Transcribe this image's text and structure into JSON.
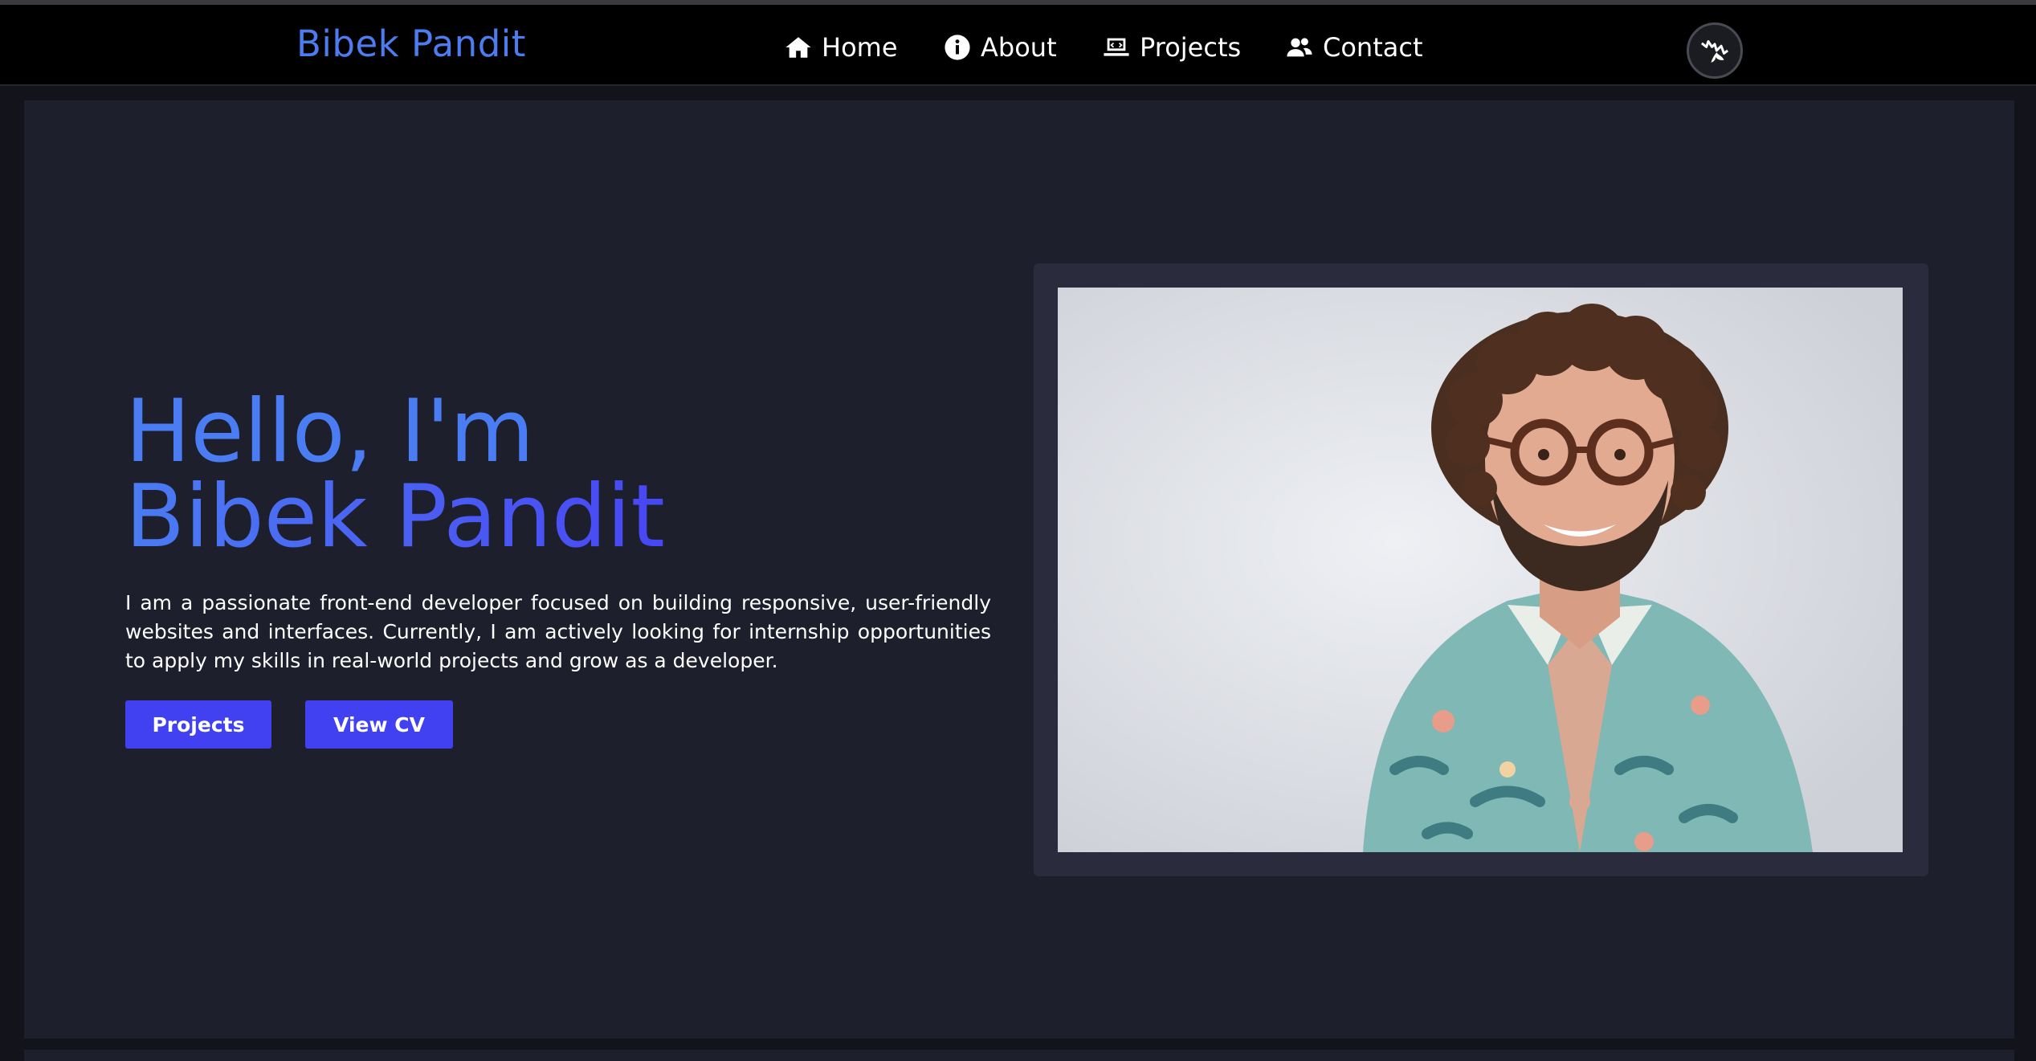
{
  "brand": {
    "name": "Bibek Pandit",
    "color": "#4d7cf0"
  },
  "nav": {
    "items": [
      {
        "label": "Home",
        "icon": "home-icon"
      },
      {
        "label": "About",
        "icon": "info-icon"
      },
      {
        "label": "Projects",
        "icon": "laptop-icon"
      },
      {
        "label": "Contact",
        "icon": "contacts-icon"
      }
    ],
    "theme_toggle_icon": "theme-toggle-icon"
  },
  "hero": {
    "greeting": "Hello, I'm",
    "name": "Bibek Pandit",
    "description": "I am a passionate front-end developer focused on building responsive, user-friendly websites and interfaces. Currently, I am actively looking for internship opportunities to apply my skills in real-world projects and grow as a developer.",
    "buttons": {
      "projects_label": "Projects",
      "cv_label": "View CV"
    },
    "photo_subject": "portrait-photo"
  },
  "colors": {
    "accent_blue": "#4a7cf3",
    "button_blue": "#4141f2",
    "background": "#1d1f2c",
    "navbar": "#000000"
  }
}
